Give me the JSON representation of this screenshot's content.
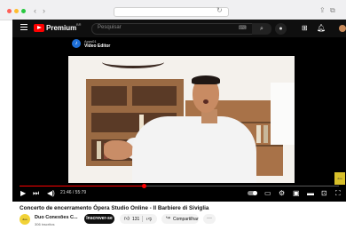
{
  "browser": {
    "back_icon": "chevron-left-icon",
    "forward_icon": "chevron-right-icon",
    "window_dots": [
      "#ff5f57",
      "#febc2e",
      "#28c840"
    ]
  },
  "topbar": {
    "brand": "Premium",
    "brand_sup": "BR",
    "search_placeholder": "Pesquisar",
    "accent": "#ff0000"
  },
  "video": {
    "channel_small": "Apps01",
    "channel_label": "Video Editor",
    "time": "21:46 / 55:79",
    "progress": 0.39
  },
  "info": {
    "title": "Concerto de encerramento Ópera Studio Online - Il Barbiere di Siviglia",
    "channel_name": "Duo Conexões C...",
    "subscribers": "306 inscritos",
    "subscribe_label": "Inscrever-se",
    "likes": "131",
    "share_label": "Compartilhar",
    "more_label": "···"
  }
}
